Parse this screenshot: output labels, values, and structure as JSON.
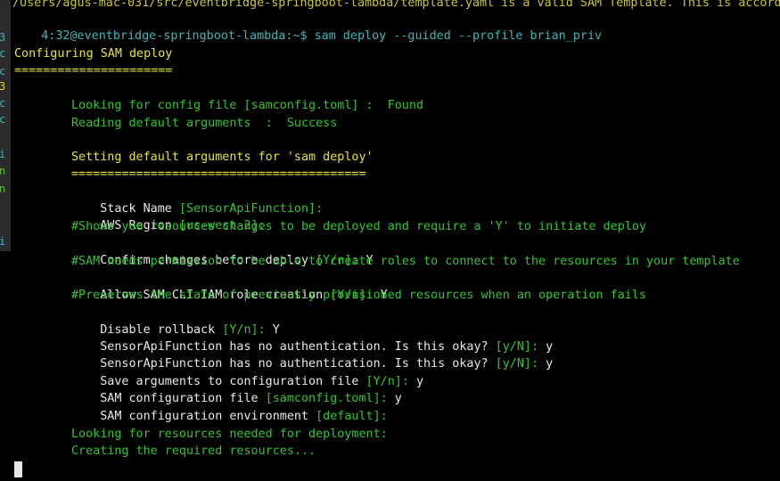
{
  "terminal": {
    "top_line": "/Users/agus-mac-031/src/eventbridge-springboot-lambda/template.yaml is a valid SAM Template. This is accord",
    "prompt": "4:32@eventbridge-springboot-lambda:~$ ",
    "command": "sam deploy --guided --profile brian_priv",
    "config_title": "Configuring SAM deploy",
    "config_underline": "======================",
    "lookup_config": "Looking for config file [samconfig.toml] :  Found",
    "read_defaults": "Reading default arguments  :  Success",
    "setting_defaults": "Setting default arguments for 'sam deploy'",
    "setting_underline": "=========================================",
    "prompts": [
      {
        "label": "Stack Name ",
        "hint": "[SensorApiFunction]:",
        "answer": ""
      },
      {
        "label": "AWS Region ",
        "hint": "[us-west-2]:",
        "answer": ""
      },
      {
        "comment": "#Shows you resources changes to be deployed and require a 'Y' to initiate deploy"
      },
      {
        "label": "Confirm changes before deploy ",
        "hint": "[Y/n]:",
        "answer": " Y"
      },
      {
        "comment": "#SAM needs permission to be able to create roles to connect to the resources in your template"
      },
      {
        "label": "Allow SAM CLI IAM role creation ",
        "hint": "[Y/n]:",
        "answer": " Y"
      },
      {
        "comment": "#Preserves the state of previously provisioned resources when an operation fails"
      },
      {
        "label": "Disable rollback ",
        "hint": "[Y/n]:",
        "answer": " Y"
      },
      {
        "label": "SensorApiFunction has no authentication. Is this okay? ",
        "hint": "[y/N]:",
        "answer": " y"
      },
      {
        "label": "SensorApiFunction has no authentication. Is this okay? ",
        "hint": "[y/N]:",
        "answer": " y"
      },
      {
        "label": "Save arguments to configuration file ",
        "hint": "[Y/n]:",
        "answer": " y"
      },
      {
        "label": "SAM configuration file ",
        "hint": "[samconfig.toml]:",
        "answer": " y"
      },
      {
        "label": "SAM configuration environment ",
        "hint": "[default]:",
        "answer": ""
      }
    ],
    "lookup_resources": "Looking for resources needed for deployment:",
    "creating_resources": "Creating the required resources..."
  },
  "left_edge_fragments": [
    "3",
    "c",
    "c",
    "3",
    "c",
    "c",
    "i",
    "n",
    "n",
    "i"
  ],
  "colors": {
    "background": "#000000",
    "prompt": "#3fb6b8",
    "heading": "#e8e23a",
    "status": "#33c533",
    "label": "#e8e8e8"
  }
}
